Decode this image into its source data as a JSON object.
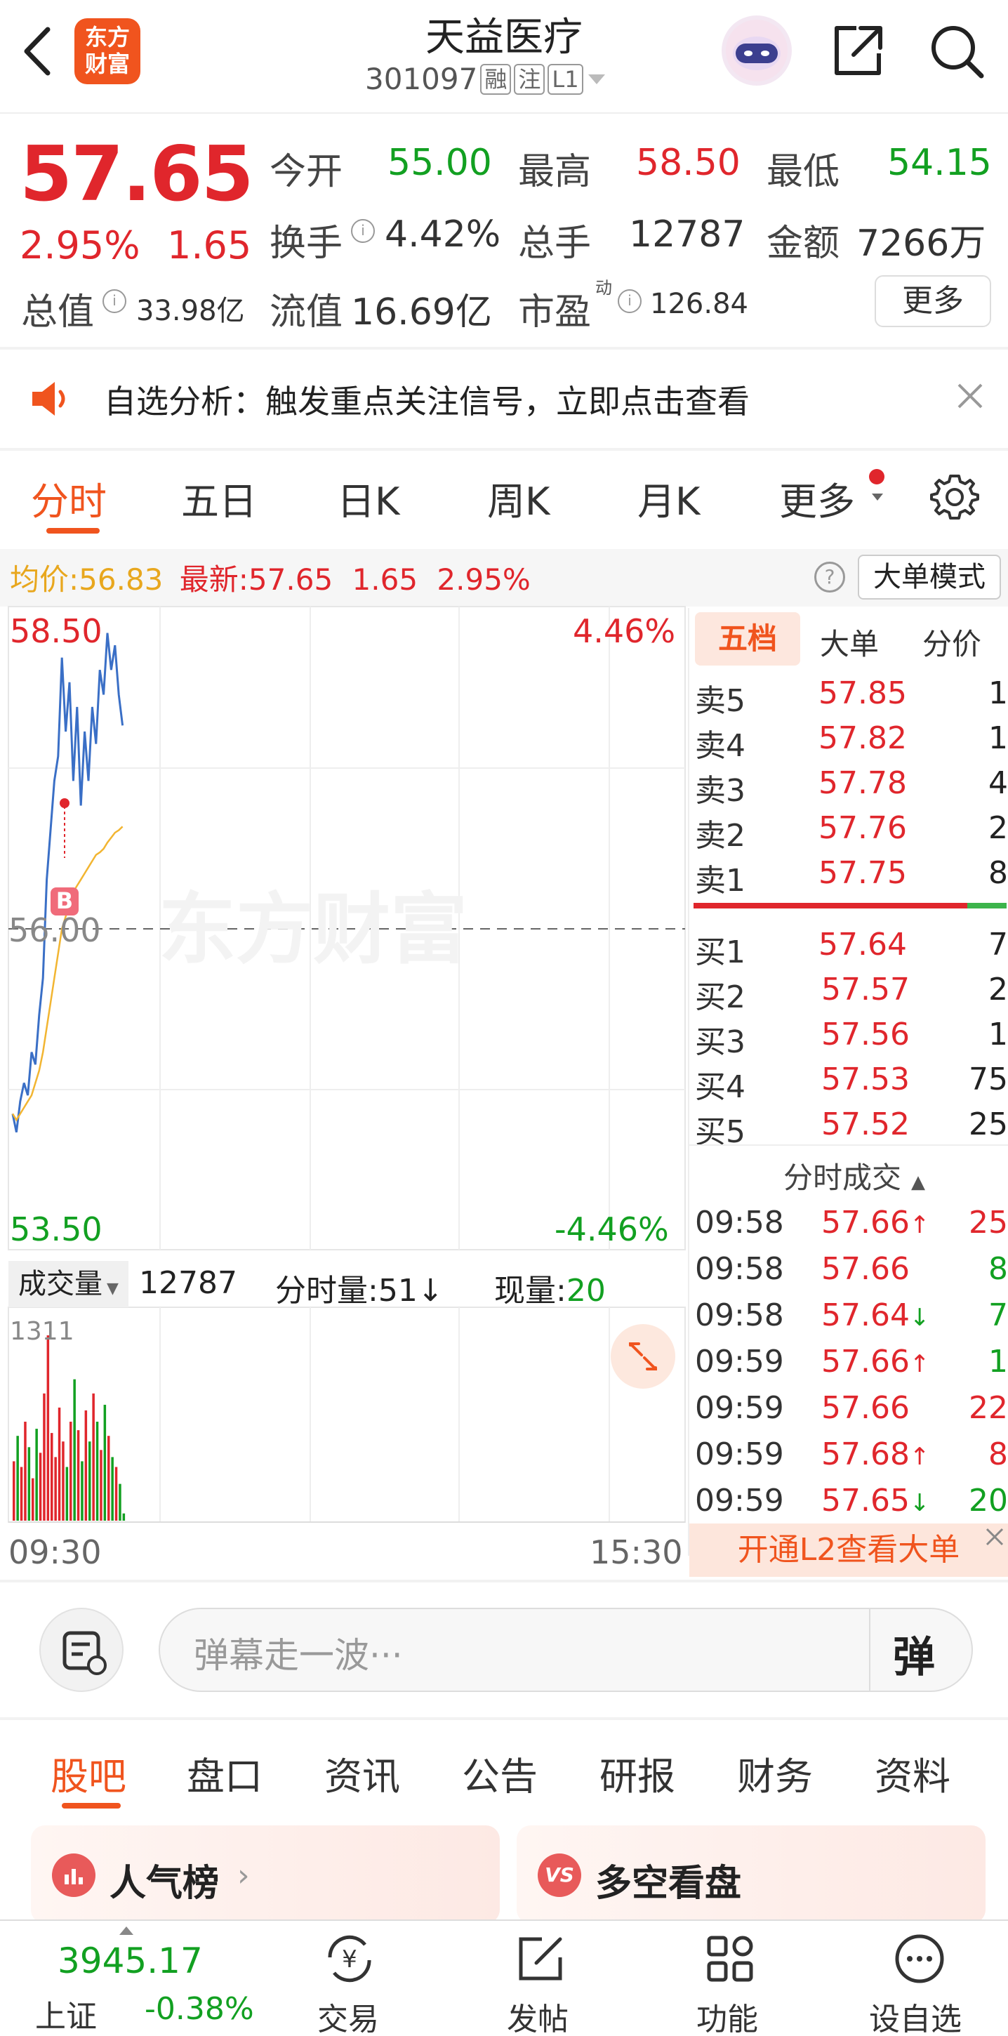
{
  "header": {
    "logo_text": "东方财富",
    "stock_name": "天益医疗",
    "stock_code": "301097",
    "tags": [
      "融",
      "注",
      "L1"
    ]
  },
  "quote": {
    "price": "57.65",
    "change_pct": "2.95%",
    "change": "1.65",
    "open_label": "今开",
    "open": "55.00",
    "high_label": "最高",
    "high": "58.50",
    "low_label": "最低",
    "low": "54.15",
    "turnover_label": "换手",
    "turnover": "4.42%",
    "volume_label": "总手",
    "volume": "12787",
    "amount_label": "金额",
    "amount": "7266万",
    "total_mv_label": "总值",
    "total_mv": "33.98亿",
    "float_mv_label": "流值",
    "float_mv": "16.69亿",
    "pe_label": "市盈",
    "pe_sup": "动",
    "pe": "126.84",
    "more_button": "更多"
  },
  "notice": {
    "text": "自选分析：触发重点关注信号，立即点击查看"
  },
  "kline_tabs": [
    "分时",
    "五日",
    "日K",
    "周K",
    "月K",
    "更多"
  ],
  "chart_header": {
    "avg_label": "均价:",
    "avg": "56.83",
    "latest_label": "最新:",
    "latest": "57.65",
    "latest_chg": "1.65",
    "latest_pct": "2.95%",
    "mode_button": "大单模式"
  },
  "chart": {
    "y_top": "58.50",
    "y_mid": "56.00",
    "y_bottom": "53.50",
    "pct_top": "4.46%",
    "pct_bottom": "-4.46%",
    "watermark": "东方财富",
    "buy_marker": "B",
    "time_start": "09:30",
    "time_end": "15:30",
    "vol_selector": "成交量",
    "vol_total": "12787",
    "vol_minute_label": "分时量:",
    "vol_minute": "51",
    "vol_now_label": "现量:",
    "vol_now": "20",
    "vol_max": "1311"
  },
  "chart_data": {
    "type": "line",
    "title": "",
    "xlabel": "",
    "ylabel": "",
    "ylim": [
      53.5,
      58.5
    ],
    "x": [
      "09:30",
      "09:31",
      "09:32",
      "09:33",
      "09:34",
      "09:35",
      "09:36",
      "09:37",
      "09:38",
      "09:39",
      "09:40",
      "09:41",
      "09:42",
      "09:43",
      "09:44",
      "09:45",
      "09:46",
      "09:47",
      "09:48",
      "09:49",
      "09:50",
      "09:51",
      "09:52",
      "09:53",
      "09:54",
      "09:55",
      "09:56",
      "09:57",
      "09:58",
      "09:59"
    ],
    "series": [
      {
        "values": [
          54.5,
          54.35,
          54.6,
          54.75,
          54.65,
          55.0,
          54.9,
          55.3,
          55.6,
          56.4,
          56.8,
          57.2,
          57.4,
          58.2,
          57.6,
          58.0,
          57.2,
          57.8,
          57.0,
          57.6,
          57.2,
          57.8,
          57.5,
          58.1,
          57.9,
          58.4,
          58.1,
          58.3,
          57.9,
          57.65
        ]
      },
      {
        "values": [
          54.5,
          54.45,
          54.5,
          54.55,
          54.6,
          54.65,
          54.75,
          54.85,
          55.0,
          55.2,
          55.4,
          55.6,
          55.8,
          56.0,
          56.1,
          56.2,
          56.3,
          56.35,
          56.4,
          56.45,
          56.5,
          56.55,
          56.6,
          56.62,
          56.65,
          56.7,
          56.74,
          56.78,
          56.8,
          56.83
        ]
      }
    ],
    "volume": [
      420,
      600,
      380,
      700,
      520,
      300,
      650,
      480,
      900,
      1311,
      620,
      450,
      800,
      560,
      380,
      700,
      1000,
      640,
      420,
      780,
      560,
      900,
      700,
      500,
      820,
      600,
      450,
      380,
      260,
      51
    ]
  },
  "orderbook": {
    "tabs": [
      "五档",
      "大单",
      "分价"
    ],
    "asks": [
      {
        "label": "卖5",
        "price": "57.85",
        "vol": "1"
      },
      {
        "label": "卖4",
        "price": "57.82",
        "vol": "1"
      },
      {
        "label": "卖3",
        "price": "57.78",
        "vol": "4"
      },
      {
        "label": "卖2",
        "price": "57.76",
        "vol": "2"
      },
      {
        "label": "卖1",
        "price": "57.75",
        "vol": "8"
      }
    ],
    "bids": [
      {
        "label": "买1",
        "price": "57.64",
        "vol": "7"
      },
      {
        "label": "买2",
        "price": "57.57",
        "vol": "2"
      },
      {
        "label": "买3",
        "price": "57.56",
        "vol": "1"
      },
      {
        "label": "买4",
        "price": "57.53",
        "vol": "75"
      },
      {
        "label": "买5",
        "price": "57.52",
        "vol": "25"
      }
    ],
    "trades_title": "分时成交",
    "trades": [
      {
        "time": "09:58",
        "price": "57.66",
        "arrow": "↑",
        "vol": "25",
        "dir": "up"
      },
      {
        "time": "09:58",
        "price": "57.66",
        "arrow": "",
        "vol": "8",
        "dir": "up"
      },
      {
        "time": "09:58",
        "price": "57.64",
        "arrow": "↓",
        "vol": "7",
        "dir": "down"
      },
      {
        "time": "09:59",
        "price": "57.66",
        "arrow": "↑",
        "vol": "1",
        "dir": "up"
      },
      {
        "time": "09:59",
        "price": "57.66",
        "arrow": "",
        "vol": "22",
        "dir": "up"
      },
      {
        "time": "09:59",
        "price": "57.68",
        "arrow": "↑",
        "vol": "8",
        "dir": "up"
      },
      {
        "time": "09:59",
        "price": "57.65",
        "arrow": "↓",
        "vol": "20",
        "dir": "down"
      }
    ],
    "l2_banner": "开通L2查看大单"
  },
  "danmu": {
    "placeholder": "弹幕走一波···",
    "send": "弹"
  },
  "bottom_tabs": [
    "股吧",
    "盘口",
    "资讯",
    "公告",
    "研报",
    "财务",
    "资料"
  ],
  "cards": [
    {
      "title": "人气榜"
    },
    {
      "title": "多空看盘"
    }
  ],
  "bottom_nav": {
    "index_value": "3945.17",
    "index_name": "上证",
    "index_change": "-0.38%",
    "items": [
      "交易",
      "发帖",
      "功能",
      "设自选"
    ]
  },
  "colors": {
    "up": "#e0262c",
    "down": "#12a021",
    "accent": "#f0541e",
    "price_line": "#3a6fc6",
    "avg_line": "#f2b531"
  }
}
